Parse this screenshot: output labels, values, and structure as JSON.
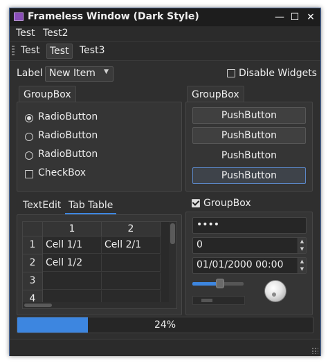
{
  "window": {
    "title": "Frameless Window (Dark Style)",
    "minimize_glyph": "—",
    "maximize_glyph": "☐",
    "close_glyph": "✕"
  },
  "menubar": {
    "items": [
      "Test",
      "Test2"
    ]
  },
  "toolbar": {
    "tabs": [
      "Test",
      "Test",
      "Test3"
    ],
    "active_index": 1
  },
  "top_row": {
    "label": "Label",
    "combo_value": "New Item",
    "combo_arrow": "▼",
    "disable_widgets_label": "Disable Widgets",
    "disable_widgets_checked": false
  },
  "left_group": {
    "title": "GroupBox",
    "radios": [
      {
        "label": "RadioButton",
        "checked": true
      },
      {
        "label": "RadioButton",
        "checked": false
      },
      {
        "label": "RadioButton",
        "checked": false
      }
    ],
    "checkbox": {
      "label": "CheckBox",
      "checked": false
    }
  },
  "right_group": {
    "title": "GroupBox",
    "buttons": [
      "PushButton",
      "PushButton",
      "PushButton",
      "PushButton"
    ]
  },
  "tab_widget": {
    "tabs": [
      "TextEdit",
      "Tab Table"
    ],
    "active_index": 1,
    "table": {
      "columns": [
        "1",
        "2"
      ],
      "rows": [
        {
          "header": "1",
          "cells": [
            "Cell 1/1",
            "Cell 2/1"
          ]
        },
        {
          "header": "2",
          "cells": [
            "Cell 1/2",
            ""
          ]
        },
        {
          "header": "3",
          "cells": [
            "",
            ""
          ]
        },
        {
          "header": "4",
          "cells": [
            "",
            ""
          ]
        }
      ]
    }
  },
  "checkable_group": {
    "title": "GroupBox",
    "checked": true,
    "password_value": "••••",
    "spin_value": "0",
    "datetime_value": "01/01/2000 00:00",
    "spin_up": "▲",
    "spin_down": "▼",
    "slider_fraction": 0.55
  },
  "progress": {
    "value_fraction": 0.24,
    "text": "24%"
  },
  "colors": {
    "accent": "#3d86e0",
    "window_bg": "#2f2f2f",
    "titlebar": "#1d1d1d"
  }
}
